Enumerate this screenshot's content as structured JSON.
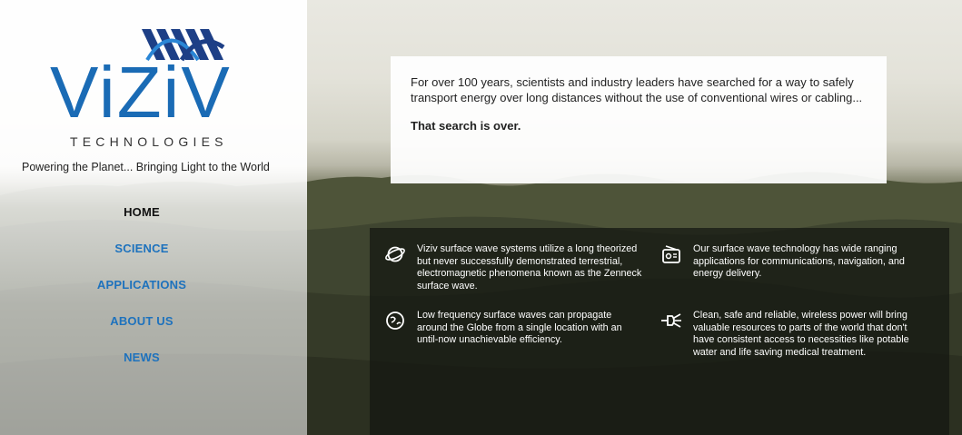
{
  "brand": {
    "name": "ViZiV",
    "subtitle": "TECHNOLOGIES",
    "tagline": "Powering the Planet... Bringing Light to the World",
    "colors": {
      "primary": "#1a6bb5",
      "dark_blue": "#1d3f86"
    }
  },
  "nav": {
    "items": [
      {
        "label": "HOME",
        "active": true
      },
      {
        "label": "SCIENCE",
        "active": false
      },
      {
        "label": "APPLICATIONS",
        "active": false
      },
      {
        "label": "ABOUT US",
        "active": false
      },
      {
        "label": "NEWS",
        "active": false
      }
    ]
  },
  "intro": {
    "text": "For over 100 years, scientists and industry leaders have searched for a way to safely transport energy over long distances without the use of conventional wires or cabling...",
    "highlight": "That search is over."
  },
  "features": [
    {
      "icon": "planet-icon",
      "text": "Viziv surface wave systems utilize a long theorized but never successfully demonstrated terrestrial, electromagnetic phenomena known as the Zenneck surface wave."
    },
    {
      "icon": "radio-icon",
      "text": "Our surface wave technology has wide ranging applications for communications, navigation, and energy delivery."
    },
    {
      "icon": "globe-icon",
      "text": "Low frequency surface waves can propagate around the Globe from a single location with an until-now unachievable efficiency."
    },
    {
      "icon": "plug-icon",
      "text": "Clean, safe and reliable, wireless power will bring valuable resources to parts of the world that don't have consistent access to necessities like potable water and life saving medical treatment."
    }
  ]
}
